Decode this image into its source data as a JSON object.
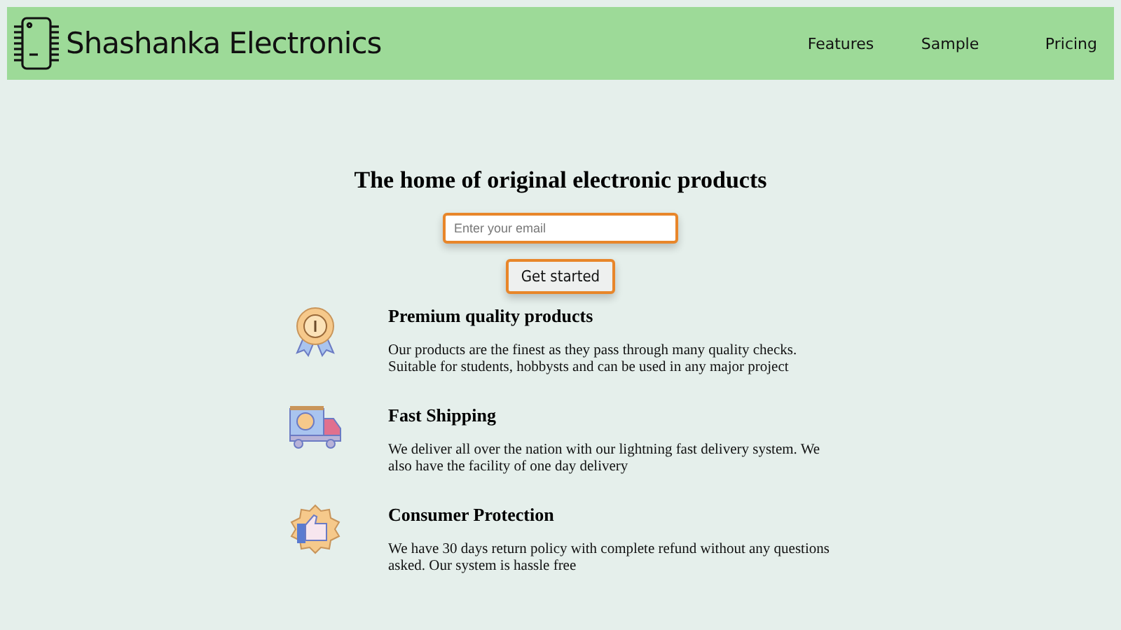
{
  "header": {
    "brand": "Shashanka Electronics",
    "nav": [
      {
        "label": "Features"
      },
      {
        "label": "Sample"
      },
      {
        "label": "Pricing"
      }
    ]
  },
  "hero": {
    "title": "The home of original electronic products",
    "email": {
      "placeholder": "Enter your email"
    },
    "button": "Get started"
  },
  "features": [
    {
      "kind": "medal",
      "title": "Premium quality products",
      "text": "Our products are the finest as they pass through many quality checks. Suitable for students, hobbysts and can be used in any major project"
    },
    {
      "kind": "truck",
      "title": "Fast Shipping",
      "text": "We deliver all over the nation with our lightning fast delivery system. We also have the facility of one day delivery"
    },
    {
      "kind": "thumbs-up",
      "title": "Consumer Protection",
      "text": "We have 30 days return policy with complete refund without any questions asked. Our system is hassle free"
    }
  ]
}
